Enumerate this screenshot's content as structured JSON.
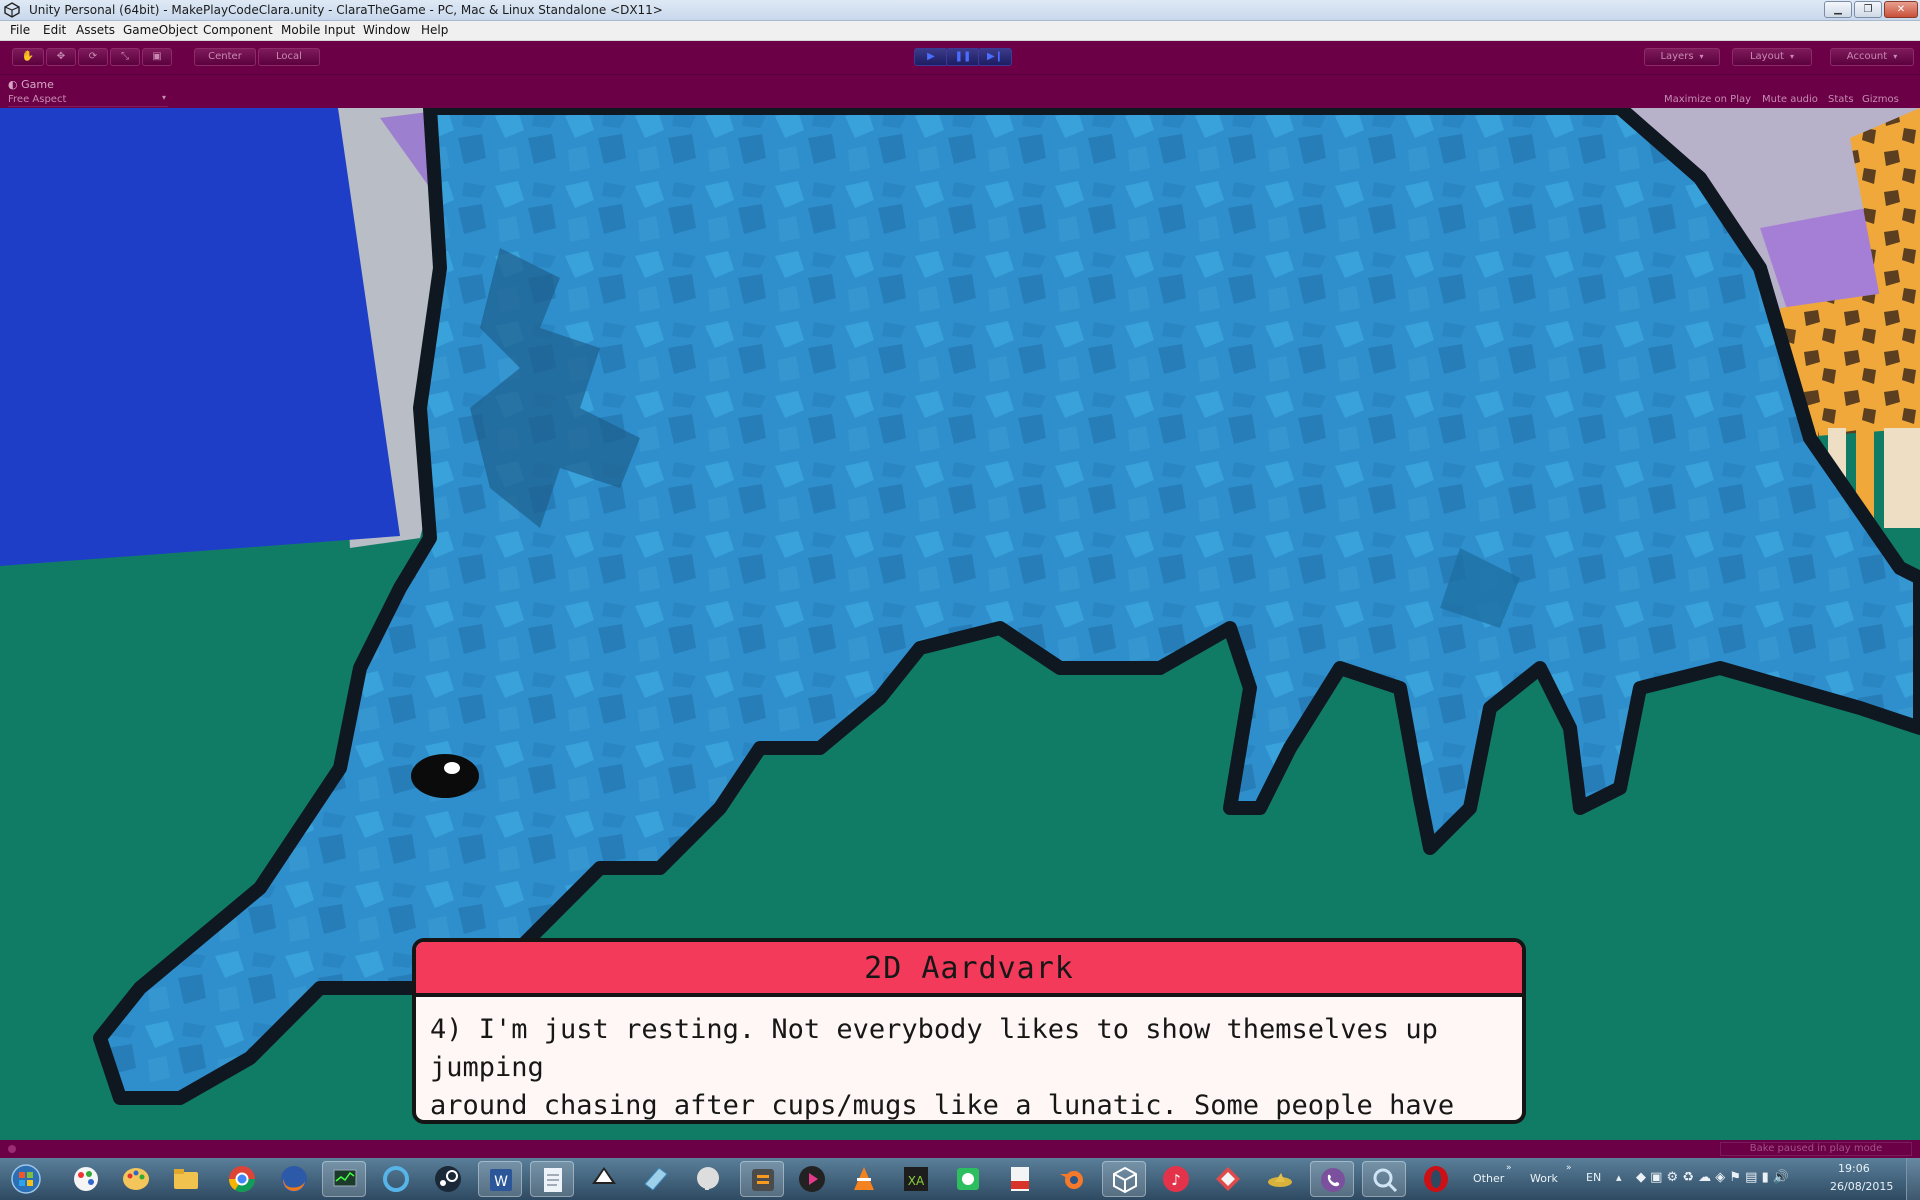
{
  "window": {
    "title": "Unity Personal (64bit) - MakePlayCodeClara.unity - ClaraTheGame - PC, Mac & Linux Standalone <DX11>"
  },
  "menu": [
    "File",
    "Edit",
    "Assets",
    "GameObject",
    "Component",
    "Mobile Input",
    "Window",
    "Help"
  ],
  "toolbar": {
    "tools": [
      "hand-tool-icon",
      "move-tool-icon",
      "rotate-tool-icon",
      "scale-tool-icon",
      "rect-tool-icon"
    ],
    "pivot": "Center",
    "space": "Local",
    "playback": [
      "play-icon",
      "pause-icon",
      "step-icon"
    ],
    "layers": "Layers",
    "layout": "Layout",
    "account": "Account"
  },
  "game_panel": {
    "tab": "Game",
    "aspect": "Free Aspect",
    "options": [
      "Maximize on Play",
      "Mute audio",
      "Stats",
      "Gizmos"
    ]
  },
  "dialog": {
    "title": "2D Aardvark",
    "line1": "4) I'm just resting. Not everybody likes to show themselves up jumping",
    "line2": "around chasing after cups/mugs like a lunatic. Some people have class."
  },
  "status_bar": {
    "message": "Bake paused in play mode"
  },
  "taskbar": {
    "apps": [
      "paint-icon",
      "chrome-icon",
      "firefox-icon",
      "steam-icon",
      "word-icon",
      "vlc-icon",
      "evernote-icon",
      "blender-icon",
      "unity-icon",
      "itunes-icon",
      "viber-icon",
      "opera-icon"
    ],
    "toolbars": [
      "Other",
      "Work"
    ],
    "language": "EN",
    "time": "19:06",
    "date": "26/08/2015"
  },
  "colors": {
    "editor_tint": "#6b0047",
    "ground": "#117c66",
    "aardvark": "#2f8fcc",
    "dialog_header": "#f33a5a"
  }
}
